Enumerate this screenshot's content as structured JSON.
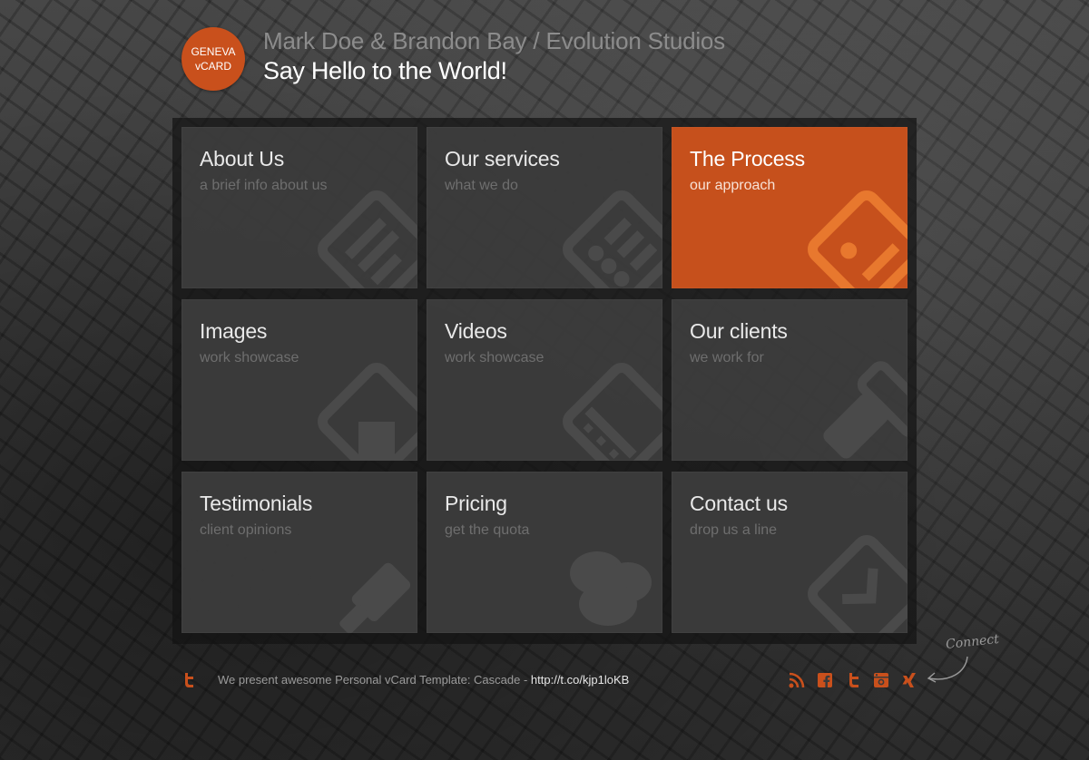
{
  "logo": {
    "line1": "GENEVA",
    "line2": "vCARD"
  },
  "header": {
    "title": "Mark Doe & Brandon Bay / Evolution Studios",
    "subtitle": "Say Hello to the World!"
  },
  "tiles": [
    {
      "title": "About Us",
      "subtitle": "a brief info about us",
      "icon": "document-icon",
      "active": false
    },
    {
      "title": "Our services",
      "subtitle": "what we do",
      "icon": "list-icon",
      "active": false
    },
    {
      "title": "The Process",
      "subtitle": "our approach",
      "icon": "process-icon",
      "active": true
    },
    {
      "title": "Images",
      "subtitle": "work showcase",
      "icon": "image-icon",
      "active": false
    },
    {
      "title": "Videos",
      "subtitle": "work showcase",
      "icon": "film-icon",
      "active": false
    },
    {
      "title": "Our clients",
      "subtitle": "we work for",
      "icon": "briefcase-icon",
      "active": false
    },
    {
      "title": "Testimonials",
      "subtitle": "client opinions",
      "icon": "brush-icon",
      "active": false
    },
    {
      "title": "Pricing",
      "subtitle": "get the quota",
      "icon": "coins-icon",
      "active": false
    },
    {
      "title": "Contact us",
      "subtitle": "drop us a line",
      "icon": "mail-icon",
      "active": false
    }
  ],
  "footer": {
    "tweet_text": "We present awesome Personal vCard Template: Cascade - ",
    "tweet_link": "http://t.co/kjp1loKB",
    "connect_label": "Connect",
    "social": [
      "rss-icon",
      "facebook-icon",
      "twitter-icon",
      "instagram-icon",
      "xing-icon"
    ]
  },
  "colors": {
    "accent": "#c9501c",
    "tile": "#3e3e3e",
    "panel": "#141414"
  }
}
